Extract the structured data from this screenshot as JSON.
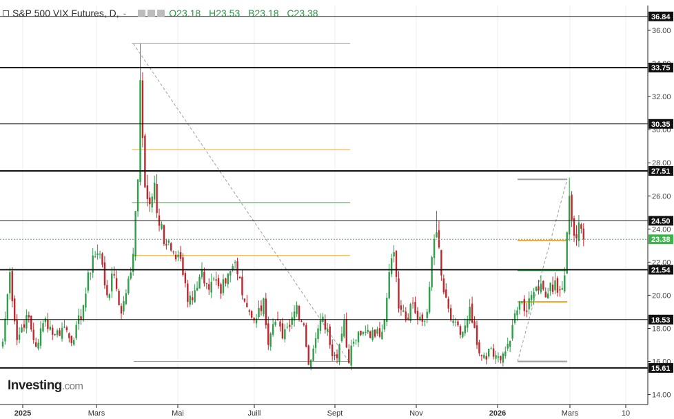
{
  "header": {
    "title": "S&P 500 VIX Futures, D,",
    "dash": "-",
    "open": "O23.18",
    "high": "H23.53",
    "low": "B23.18",
    "close": "C23.38",
    "ohlc_color": "#2a9a44"
  },
  "logo": {
    "main": "Investing",
    "suffix": ".com"
  },
  "colors": {
    "up": "#2e9e48",
    "down": "#c0262b",
    "orange": "#f5a623",
    "green_line": "#3cb44b",
    "grey": "#9e9e9e"
  },
  "chart_data": {
    "type": "candlestick",
    "ylim": [
      13.4,
      37.5
    ],
    "y_ticks": [
      "14.00",
      "16.00",
      "18.00",
      "20.00",
      "22.00",
      "24.00",
      "26.00",
      "28.00",
      "30.00",
      "32.00",
      "34.00",
      "36.00"
    ],
    "x_ticks": [
      "2025",
      "Mars",
      "Mai",
      "Juill",
      "Sept",
      "Nov",
      "2026",
      "Mars",
      "10"
    ],
    "last_price": {
      "value": 23.38,
      "label": "23.38",
      "color": "#3cb44b"
    },
    "horizontal_levels": [
      {
        "value": 36.84,
        "label": "36.84",
        "weight": 1
      },
      {
        "value": 33.75,
        "label": "33.75",
        "weight": 2
      },
      {
        "value": 30.35,
        "label": "30.35",
        "weight": 1
      },
      {
        "value": 27.51,
        "label": "27.51",
        "weight": 2
      },
      {
        "value": 24.5,
        "label": "24.50",
        "weight": 1
      },
      {
        "value": 21.54,
        "label": "21.54",
        "weight": 2
      },
      {
        "value": 18.53,
        "label": "18.53",
        "weight": 1
      },
      {
        "value": 15.61,
        "label": "15.61",
        "weight": 2
      }
    ],
    "fib_levels_1": {
      "top": 35.2,
      "upper": 28.8,
      "middle": 25.6,
      "lower": 22.4,
      "bottom": 16.0
    },
    "fib_levels_2": {
      "top": 27.0,
      "upper": 23.3,
      "middle": 21.5,
      "lower": 19.6,
      "bottom": 16.0
    },
    "anchors": [
      {
        "i": 0,
        "v": 17.2
      },
      {
        "i": 3,
        "v": 21.4
      },
      {
        "i": 6,
        "v": 17.3
      },
      {
        "i": 10,
        "v": 18.8
      },
      {
        "i": 14,
        "v": 16.9
      },
      {
        "i": 18,
        "v": 18.6
      },
      {
        "i": 22,
        "v": 17.6
      },
      {
        "i": 26,
        "v": 18.1
      },
      {
        "i": 30,
        "v": 17.3
      },
      {
        "i": 34,
        "v": 19.4
      },
      {
        "i": 38,
        "v": 22.4
      },
      {
        "i": 41,
        "v": 22.5
      },
      {
        "i": 44,
        "v": 20.0
      },
      {
        "i": 47,
        "v": 21.2
      },
      {
        "i": 50,
        "v": 18.9
      },
      {
        "i": 53,
        "v": 21.0
      },
      {
        "i": 55,
        "v": 22.5
      },
      {
        "i": 57,
        "v": 27.0
      },
      {
        "i": 58,
        "v": 33.0
      },
      {
        "i": 59,
        "v": 29.5
      },
      {
        "i": 60,
        "v": 26.5
      },
      {
        "i": 62,
        "v": 25.5
      },
      {
        "i": 64,
        "v": 26.8
      },
      {
        "i": 66,
        "v": 24.2
      },
      {
        "i": 69,
        "v": 23.0
      },
      {
        "i": 72,
        "v": 22.6
      },
      {
        "i": 75,
        "v": 22.2
      },
      {
        "i": 78,
        "v": 19.6
      },
      {
        "i": 81,
        "v": 20.3
      },
      {
        "i": 84,
        "v": 21.6
      },
      {
        "i": 86,
        "v": 20.7
      },
      {
        "i": 89,
        "v": 21.0
      },
      {
        "i": 92,
        "v": 20.1
      },
      {
        "i": 95,
        "v": 21.3
      },
      {
        "i": 98,
        "v": 22.0
      },
      {
        "i": 101,
        "v": 20.0
      },
      {
        "i": 104,
        "v": 19.0
      },
      {
        "i": 107,
        "v": 18.6
      },
      {
        "i": 110,
        "v": 19.8
      },
      {
        "i": 112,
        "v": 17.0
      },
      {
        "i": 115,
        "v": 18.4
      },
      {
        "i": 118,
        "v": 17.4
      },
      {
        "i": 121,
        "v": 18.1
      },
      {
        "i": 124,
        "v": 19.4
      },
      {
        "i": 127,
        "v": 18.2
      },
      {
        "i": 129,
        "v": 15.8
      },
      {
        "i": 132,
        "v": 17.4
      },
      {
        "i": 135,
        "v": 18.7
      },
      {
        "i": 138,
        "v": 17.0
      },
      {
        "i": 141,
        "v": 16.2
      },
      {
        "i": 144,
        "v": 18.5
      },
      {
        "i": 146,
        "v": 15.9
      },
      {
        "i": 148,
        "v": 17.2
      },
      {
        "i": 151,
        "v": 17.6
      },
      {
        "i": 154,
        "v": 17.9
      },
      {
        "i": 157,
        "v": 17.5
      },
      {
        "i": 160,
        "v": 17.8
      },
      {
        "i": 163,
        "v": 21.4
      },
      {
        "i": 165,
        "v": 22.6
      },
      {
        "i": 167,
        "v": 19.2
      },
      {
        "i": 170,
        "v": 18.5
      },
      {
        "i": 173,
        "v": 19.5
      },
      {
        "i": 176,
        "v": 18.7
      },
      {
        "i": 179,
        "v": 19.0
      },
      {
        "i": 182,
        "v": 23.4
      },
      {
        "i": 183,
        "v": 23.8
      },
      {
        "i": 185,
        "v": 21.2
      },
      {
        "i": 188,
        "v": 19.2
      },
      {
        "i": 191,
        "v": 18.4
      },
      {
        "i": 194,
        "v": 17.8
      },
      {
        "i": 197,
        "v": 19.3
      },
      {
        "i": 200,
        "v": 17.0
      },
      {
        "i": 203,
        "v": 16.4
      },
      {
        "i": 206,
        "v": 16.8
      },
      {
        "i": 209,
        "v": 16.3
      },
      {
        "i": 212,
        "v": 16.6
      },
      {
        "i": 215,
        "v": 18.2
      },
      {
        "i": 218,
        "v": 19.6
      },
      {
        "i": 221,
        "v": 19.0
      },
      {
        "i": 224,
        "v": 20.2
      },
      {
        "i": 227,
        "v": 20.7
      },
      {
        "i": 230,
        "v": 20.1
      },
      {
        "i": 233,
        "v": 20.9
      },
      {
        "i": 235,
        "v": 20.3
      },
      {
        "i": 237,
        "v": 21.2
      },
      {
        "i": 238,
        "v": 23.8
      },
      {
        "i": 239,
        "v": 26.0
      },
      {
        "i": 241,
        "v": 23.6
      },
      {
        "i": 243,
        "v": 24.4
      },
      {
        "i": 245,
        "v": 23.38
      }
    ]
  }
}
